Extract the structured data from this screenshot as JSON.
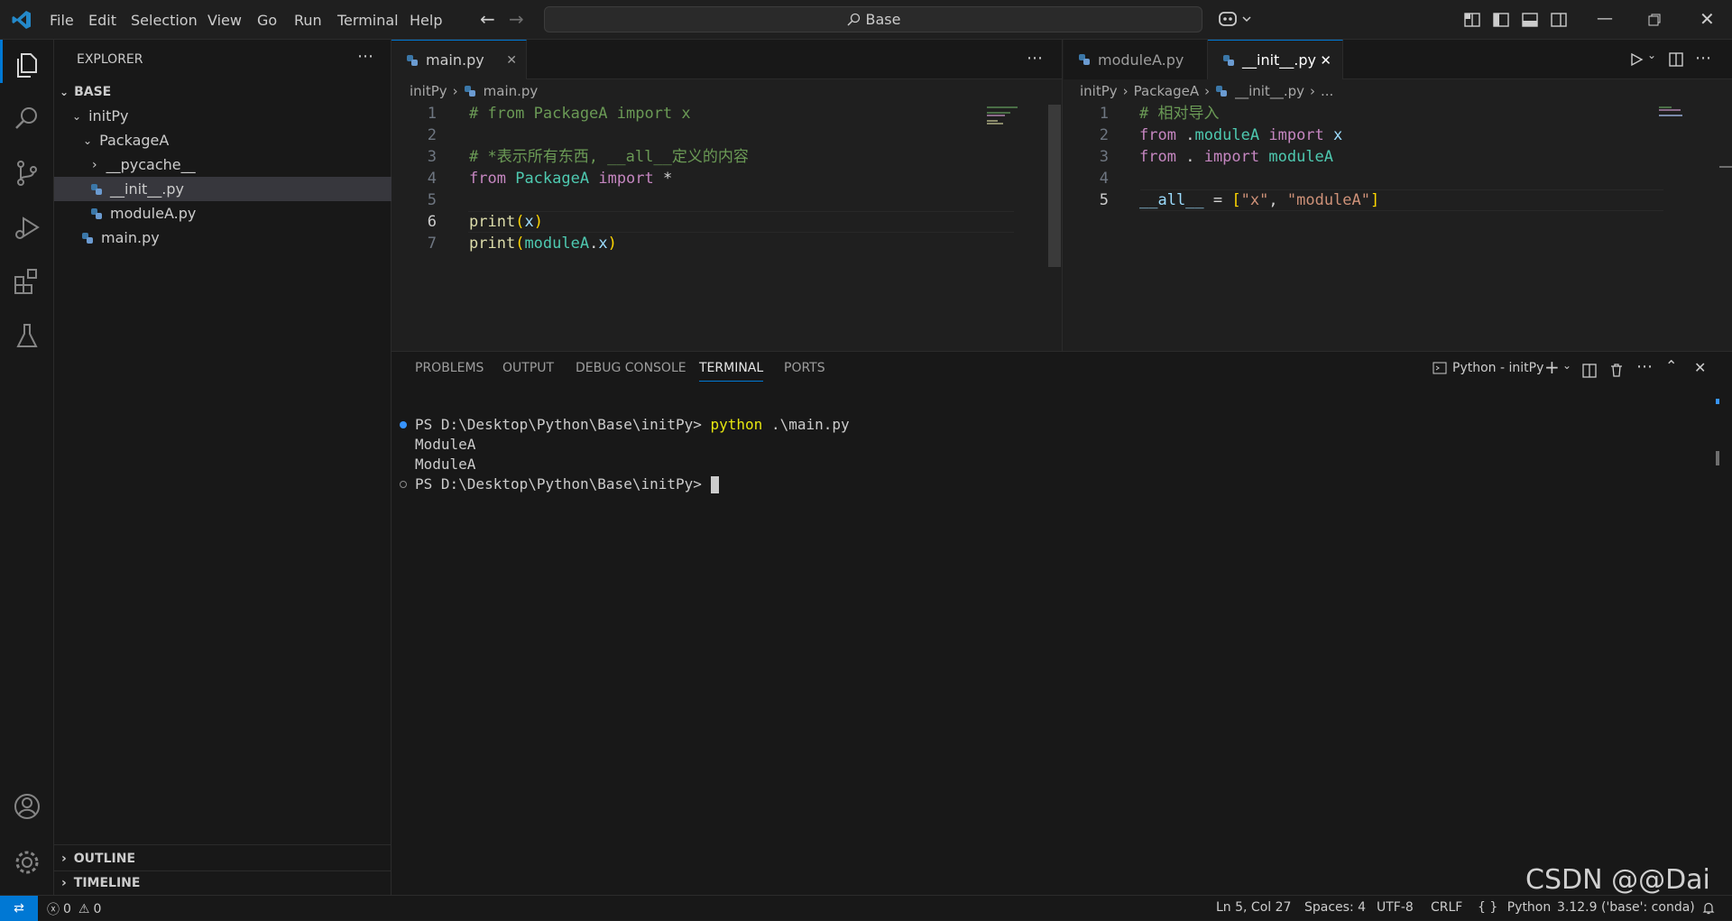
{
  "menu": [
    "File",
    "Edit",
    "Selection",
    "View",
    "Go",
    "Run",
    "Terminal",
    "Help"
  ],
  "search": {
    "text": "Base"
  },
  "explorer": {
    "title": "EXPLORER",
    "root": "BASE",
    "items": [
      {
        "label": "initPy"
      },
      {
        "label": "PackageA"
      },
      {
        "label": "__pycache__"
      },
      {
        "label": "__init__.py"
      },
      {
        "label": "moduleA.py"
      },
      {
        "label": "main.py"
      }
    ],
    "outline": "OUTLINE",
    "timeline": "TIMELINE"
  },
  "left_editor": {
    "tab": "main.py",
    "breadcrumb": [
      "initPy",
      "main.py"
    ],
    "lines": [
      "1",
      "2",
      "3",
      "4",
      "5",
      "6",
      "7"
    ]
  },
  "right_editor": {
    "tabs": [
      "moduleA.py",
      "__init__.py"
    ],
    "breadcrumb": [
      "initPy",
      "PackageA",
      "__init__.py",
      "..."
    ],
    "lines": [
      "1",
      "2",
      "3",
      "4",
      "5"
    ]
  },
  "panel": {
    "tabs": [
      "PROBLEMS",
      "OUTPUT",
      "DEBUG CONSOLE",
      "TERMINAL",
      "PORTS"
    ],
    "terminal_name": "Python - initPy",
    "terminal_lines": [
      "PS D:\\Desktop\\Python\\Base\\initPy> ",
      "python",
      " .\\main.py",
      "ModuleA",
      "ModuleA",
      "PS D:\\Desktop\\Python\\Base\\initPy> "
    ]
  },
  "status": {
    "errors": "0",
    "warnings": "0",
    "position": "Ln 5, Col 27",
    "spaces": "Spaces: 4",
    "encoding": "UTF-8",
    "eol": "CRLF",
    "language": "Python",
    "interpreter": "3.12.9 ('base': conda)"
  },
  "watermark": "CSDN @@Dai",
  "colors": {
    "accent": "#0078d4",
    "background": "#1f1f1f",
    "sidebar": "#181818"
  }
}
